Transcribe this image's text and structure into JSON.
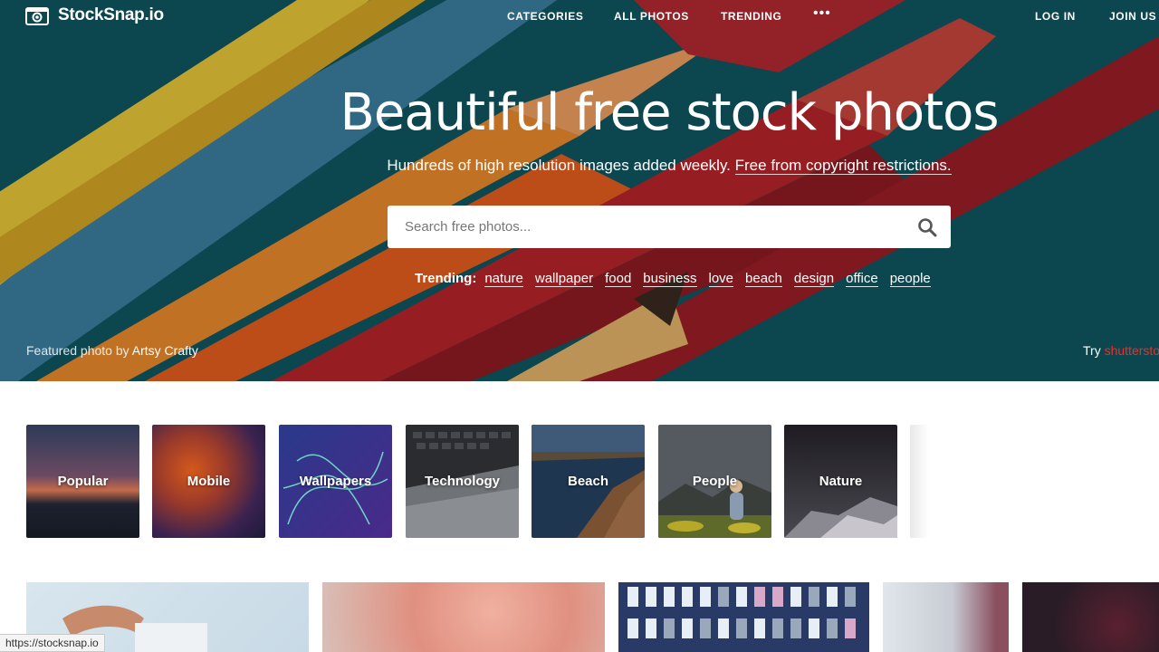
{
  "brand": {
    "name": "StockSnap.io"
  },
  "nav": {
    "categories": "CATEGORIES",
    "all_photos": "ALL PHOTOS",
    "trending": "TRENDING",
    "more": "•••",
    "login": "LOG IN",
    "join": "JOIN US"
  },
  "hero": {
    "title": "Beautiful free stock photos",
    "subtitle": "Hundreds of high resolution images added weekly.",
    "subtitle_link": "Free from copyright restrictions.",
    "search_placeholder": "Search free photos...",
    "trending_label": "Trending:",
    "trending_tags": [
      "nature",
      "wallpaper",
      "food",
      "business",
      "love",
      "beach",
      "design",
      "office",
      "people"
    ],
    "featured_prefix": "Featured photo by",
    "featured_author": "Artsy Crafty",
    "shutter_prefix": "Try",
    "shutter_link": "shutterstock"
  },
  "categories": [
    "Popular",
    "Mobile",
    "Wallpapers",
    "Technology",
    "Beach",
    "People",
    "Nature"
  ],
  "status_url": "https://stocksnap.io",
  "icons": {
    "logo": "camera-icon",
    "search": "search-icon"
  },
  "colors": {
    "accent_shutterstock": "#ee2e24",
    "hero_bg": "#0f4f58"
  }
}
